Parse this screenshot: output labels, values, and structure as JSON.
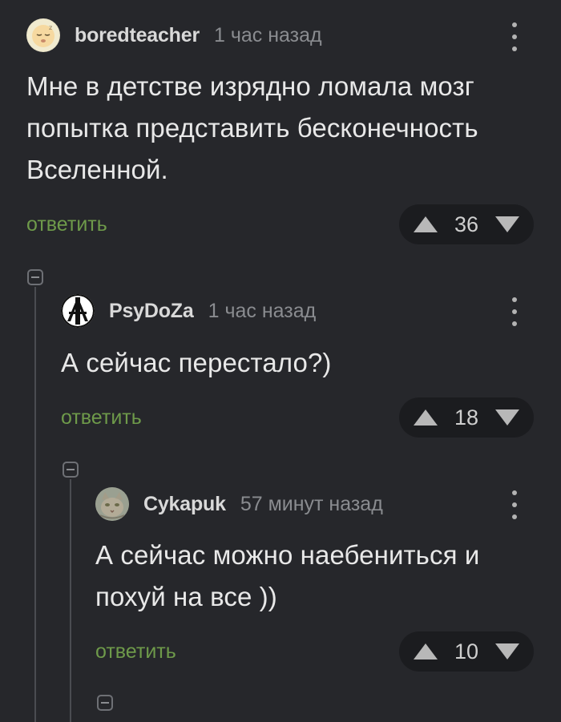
{
  "colors": {
    "background": "#26272b",
    "reply_link": "#6e9a4a",
    "vote_pill": "#1b1c1f"
  },
  "comments": [
    {
      "username": "boredteacher",
      "time": "1 час назад",
      "text_lines": [
        "Мне в детстве изрядно ломала мозг",
        "попытка представить бесконечность",
        "Вселенной."
      ],
      "reply_label": "ответить",
      "rating": "36",
      "avatar_icon": "sleepy-face-avatar-icon"
    },
    {
      "username": "PsyDoZa",
      "time": "1 час назад",
      "text_lines": [
        "А сейчас перестало?)"
      ],
      "reply_label": "ответить",
      "rating": "18",
      "avatar_icon": "anarchy-symbol-avatar-icon"
    },
    {
      "username": "Cykapuk",
      "time": "57 минут назад",
      "text_lines": [
        "А сейчас можно наебениться и",
        "похуй на все ))"
      ],
      "reply_label": "ответить",
      "rating": "10",
      "avatar_icon": "cat-photo-avatar-icon"
    }
  ]
}
